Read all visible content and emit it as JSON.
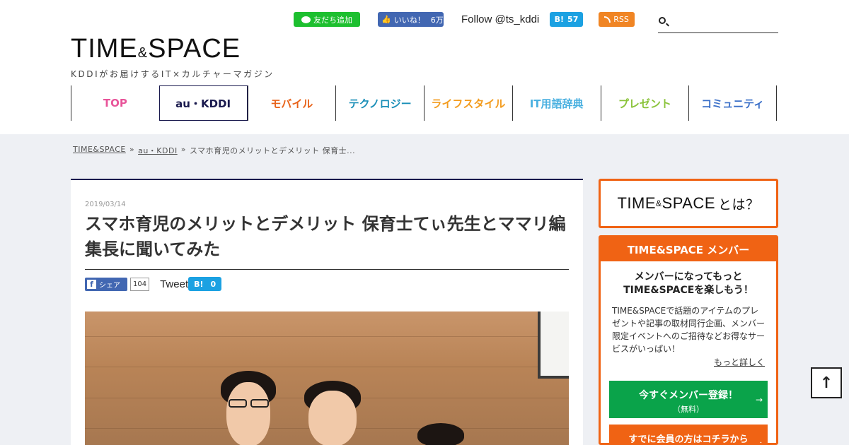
{
  "header": {
    "logo_main": "TIME",
    "logo_amp": "&",
    "logo_main2": "SPACE",
    "logo_sub": "KDDIがお届けするIT×カルチャーマガジン",
    "line_label": "友だち追加",
    "fb_like_label": "いいね！",
    "fb_like_count": "6万",
    "follow_label": "Follow @ts_kddi",
    "hatena_count": "57",
    "rss_label": "RSS",
    "search_placeholder": ""
  },
  "nav": [
    {
      "label": "TOP",
      "color": "#e8559a"
    },
    {
      "label": "au・KDDI",
      "color": "#1a1a4e"
    },
    {
      "label": "モバイル",
      "color": "#e8631a"
    },
    {
      "label": "テクノロジー",
      "color": "#1b8fb8"
    },
    {
      "label": "ライフスタイル",
      "color": "#f39c1f"
    },
    {
      "label": "IT用語辞典",
      "color": "#4ab0e0"
    },
    {
      "label": "プレゼント",
      "color": "#8ac33a"
    },
    {
      "label": "コミュニティ",
      "color": "#3a6fc8"
    }
  ],
  "breadcrumb": {
    "home": "TIME&SPACE",
    "sep1": "»",
    "category": "au・KDDI",
    "sep2": "»",
    "current": "スマホ育児のメリットとデメリット 保育士..."
  },
  "article": {
    "date": "2019/03/14",
    "title": "スマホ育児のメリットとデメリット 保育士てぃ先生とママリ編集長に聞いてみた",
    "fb_share_label": "シェア",
    "fb_share_count": "104",
    "tweet_label": "Tweet",
    "hatena_count": "0"
  },
  "sidebar": {
    "about_label": "TIME",
    "about_amp": "&",
    "about_label2": "SPACE",
    "about_suffix": "とは？",
    "member_head": "TIME&SPACE メンバー",
    "member_lead_1": "メンバーになってもっと",
    "member_lead_2": "TIME&SPACEを楽しもう！",
    "member_desc": "TIME&SPACEで話題のアイテムのプレゼントや記事の取材同行企画、メンバー限定イベントへのご招待などお得なサービスがいっぱい！",
    "member_more": "もっと詳しく",
    "register_main": "今すぐメンバー登録！",
    "register_sub": "（無料）",
    "login_label": "すでに会員の方はコチラから",
    "arrow": "→"
  },
  "to_top_icon": "arrow-up-icon"
}
